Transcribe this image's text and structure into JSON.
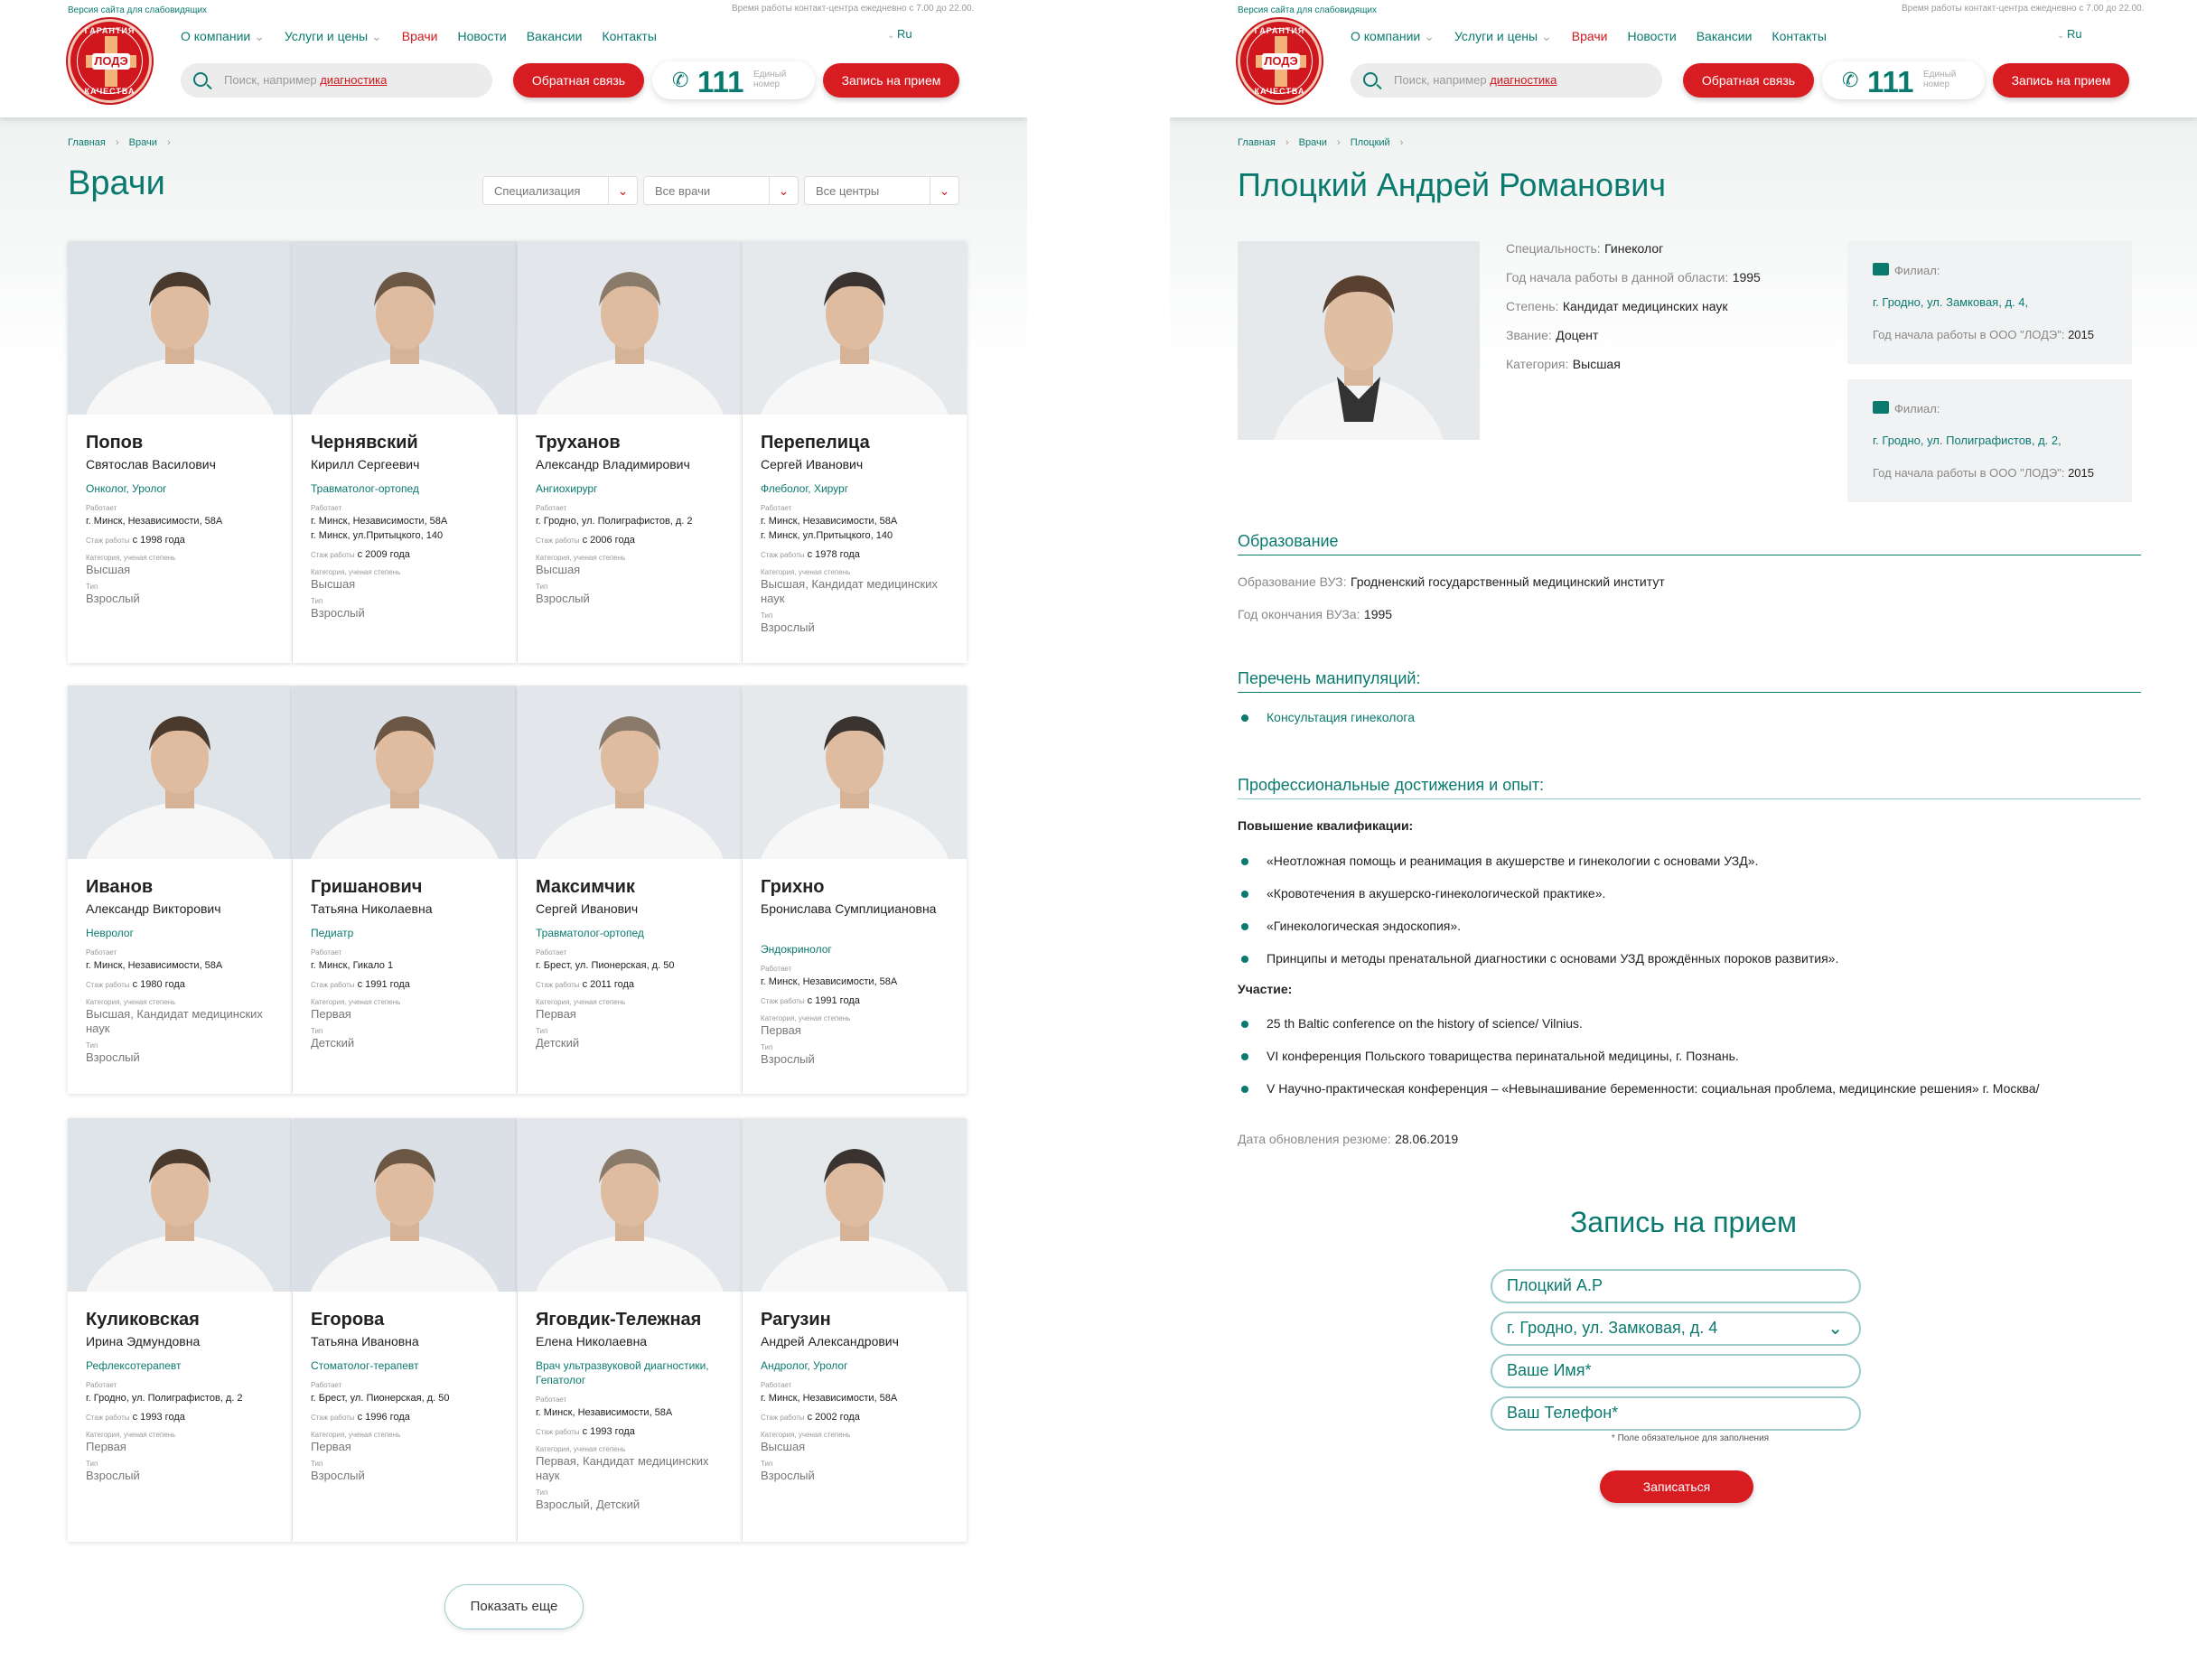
{
  "header": {
    "version_link": "Версия сайта для слабовидящих",
    "hours": "Время работы контакт-центра ежедневно с 7.00 до 22.00.",
    "nav": [
      "О компании",
      "Услуги и цены",
      "Врачи",
      "Новости",
      "Вакансии",
      "Контакты"
    ],
    "search_placeholder": "Поиск, например",
    "search_example": "диагностика",
    "feedback": "Обратная связь",
    "phone": "111",
    "phone_caption_1": "Единый",
    "phone_caption_2": "номер",
    "appointment": "Запись на прием",
    "lang": "Ru",
    "logo_top": "ГАРАНТИЯ",
    "logo_bottom": "КАЧЕСТВА",
    "logo_name": "ЛОДЭ"
  },
  "list_page": {
    "breadcrumb": [
      "Главная",
      "Врачи"
    ],
    "title": "Врачи",
    "filters": [
      "Специализация",
      "Все врачи",
      "Все центры"
    ],
    "labels": {
      "work": "Работает",
      "exp": "Стаж работы",
      "cat": "Категория, ученая степень",
      "type": "Тип"
    },
    "doctors": [
      {
        "last": "Попов",
        "first": "Святослав Василович",
        "spec": "Онколог, Уролог",
        "place": [
          "г. Минск, Независимости, 58А"
        ],
        "exp": "с 1998 года",
        "cat": "Высшая",
        "type": "Взрослый"
      },
      {
        "last": "Чернявский",
        "first": "Кирилл Сергеевич",
        "spec": "Травматолог-ортопед",
        "place": [
          "г. Минск, Независимости, 58А",
          "г. Минск, ул.Притыцкого, 140"
        ],
        "exp": "с 2009 года",
        "cat": "Высшая",
        "type": "Взрослый"
      },
      {
        "last": "Труханов",
        "first": "Александр Владимирович",
        "spec": "Ангиохирург",
        "place": [
          "г. Гродно, ул. Полиграфистов, д. 2"
        ],
        "exp": "с 2006 года",
        "cat": "Высшая",
        "type": "Взрослый"
      },
      {
        "last": "Перепелица",
        "first": "Сергей Иванович",
        "spec": "Флеболог, Хирург",
        "place": [
          "г. Минск, Независимости, 58А",
          "г. Минск, ул.Притыцкого, 140"
        ],
        "exp": "с 1978 года",
        "cat": "Высшая, Кандидат медицинских наук",
        "type": "Взрослый"
      },
      {
        "last": "Иванов",
        "first": "Александр Викторович",
        "spec": "Невролог",
        "place": [
          "г. Минск, Независимости, 58А"
        ],
        "exp": "с 1980 года",
        "cat": "Высшая, Кандидат медицинских наук",
        "type": "Взрослый"
      },
      {
        "last": "Гришанович",
        "first": "Татьяна Николаевна",
        "spec": "Педиатр",
        "place": [
          "г. Минск, Гикало 1"
        ],
        "exp": "с 1991 года",
        "cat": "Первая",
        "type": "Детский"
      },
      {
        "last": "Максимчик",
        "first": "Сергей Иванович",
        "spec": "Травматолог-ортопед",
        "place": [
          "г. Брест, ул. Пионерская, д. 50"
        ],
        "exp": "с 2011 года",
        "cat": "Первая",
        "type": "Детский"
      },
      {
        "last": "Грихно",
        "first": "Бронислава Сумплициановна",
        "spec": "Эндокринолог",
        "place": [
          "г. Минск, Независимости, 58А"
        ],
        "exp": "с 1991 года",
        "cat": "Первая",
        "type": "Взрослый"
      },
      {
        "last": "Куликовская",
        "first": "Ирина Эдмундовна",
        "spec": "Рефлексотерапевт",
        "place": [
          "г. Гродно, ул. Полиграфистов, д. 2"
        ],
        "exp": "с 1993 года",
        "cat": "Первая",
        "type": "Взрослый"
      },
      {
        "last": "Егорова",
        "first": "Татьяна Ивановна",
        "spec": "Стоматолог-терапевт",
        "place": [
          "г. Брест, ул. Пионерская, д. 50"
        ],
        "exp": "с 1996 года",
        "cat": "Первая",
        "type": "Взрослый"
      },
      {
        "last": "Яговдик-Тележная",
        "first": "Елена Николаевна",
        "spec": "Врач ультразвуковой диагностики, Гепатолог",
        "place": [
          "г. Минск, Независимости, 58А"
        ],
        "exp": "с 1993 года",
        "cat": "Первая, Кандидат медицинских наук",
        "type": "Взрослый, Детский"
      },
      {
        "last": "Рагузин",
        "first": "Андрей Александрович",
        "spec": "Андролог, Уролог",
        "place": [
          "г. Минск, Независимости, 58А"
        ],
        "exp": "с 2002 года",
        "cat": "Высшая",
        "type": "Взрослый"
      }
    ],
    "show_more": "Показать еще"
  },
  "profile_page": {
    "breadcrumb": [
      "Главная",
      "Врачи",
      "Плоцкий"
    ],
    "name": "Плоцкий Андрей Романович",
    "facts": [
      {
        "label": "Специальность:",
        "value": "Гинеколог"
      },
      {
        "label": "Год начала работы в данной области:",
        "value": "1995"
      },
      {
        "label": "Степень:",
        "value": "Кандидат медицинских наук"
      },
      {
        "label": "Звание:",
        "value": "Доцент"
      },
      {
        "label": "Категория:",
        "value": "Высшая"
      }
    ],
    "branches": [
      {
        "label": "Филиал:",
        "address": "г. Гродно, ул. Замковая, д. 4,",
        "since_label": "Год начала работы в ООО \"ЛОДЭ\":",
        "since": "2015"
      },
      {
        "label": "Филиал:",
        "address": "г. Гродно, ул. Полиграфистов, д. 2,",
        "since_label": "Год начала работы в ООО \"ЛОДЭ\":",
        "since": "2015"
      }
    ],
    "education": {
      "title": "Образование",
      "uni_label": "Образование ВУЗ:",
      "uni": "Гродненский государственный медицинский институт",
      "grad_label": "Год окончания ВУЗа:",
      "grad": "1995"
    },
    "procedures": {
      "title": "Перечень манипуляций:",
      "items": [
        "Консультация гинеколога"
      ]
    },
    "achievements": {
      "title": "Профессиональные достижения и опыт:",
      "qual_title": "Повышение квалификации:",
      "qual": [
        "«Неотложная помощь и реанимация в акушерстве и гинекологии с основами УЗД».",
        "«Кровотечения в акушерско-гинекологической практике».",
        "«Гинекологическая эндоскопия».",
        "Принципы и методы пренатальной диагностики с основами УЗД врождённых пороков развития»."
      ],
      "part_title": "Участие:",
      "part": [
        "25 th Baltic conference on the history of science/ Vilnius.",
        "VI конференция Польского товарищества перинатальной медицины, г. Познань.",
        "V Научно-практическая конференция – «Невынашивание беременности: социальная проблема, медицинские решения» г. Москва/"
      ]
    },
    "updated_label": "Дата обновления резюме:",
    "updated": "28.06.2019",
    "form": {
      "title": "Запись на прием",
      "doctor": "Плоцкий А.Р",
      "branch": "г. Гродно, ул. Замковая, д. 4",
      "name_ph": "Ваше Имя*",
      "phone_ph": "Ваш Телефон*",
      "note": "* Поле обязательное для заполнения",
      "submit": "Записаться"
    }
  }
}
